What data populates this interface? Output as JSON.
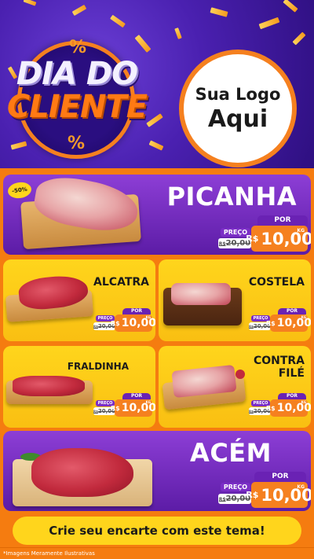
{
  "header": {
    "badge_line1": "DIA DO",
    "badge_line2": "CLIENTE",
    "percent_symbol": "%",
    "logo_line1": "Sua Logo",
    "logo_line2": "Aqui"
  },
  "products": [
    {
      "name": "PICANHA",
      "discount": "-50%",
      "por": "POR",
      "preco_label": "PREÇO",
      "old_prefix": "R$",
      "old_price": "20,00",
      "currency": "R$",
      "new_price": "10,00",
      "unit": "KG"
    },
    {
      "name": "ALCATRA",
      "por": "POR",
      "preco_label": "PREÇO",
      "old_prefix": "R$",
      "old_price": "20,00",
      "currency": "R$",
      "new_price": "10,00",
      "unit": "KG"
    },
    {
      "name": "COSTELA",
      "por": "POR",
      "preco_label": "PREÇO",
      "old_prefix": "R$",
      "old_price": "20,00",
      "currency": "R$",
      "new_price": "10,00",
      "unit": "KG"
    },
    {
      "name": "FRALDINHA",
      "por": "POR",
      "preco_label": "PREÇO",
      "old_prefix": "R$",
      "old_price": "20,00",
      "currency": "R$",
      "new_price": "10,00",
      "unit": "KG"
    },
    {
      "name_line1": "CONTRA",
      "name_line2": "FILÉ",
      "por": "POR",
      "preco_label": "PREÇO",
      "old_prefix": "R$",
      "old_price": "20,00",
      "currency": "R$",
      "new_price": "10,00",
      "unit": "KG"
    },
    {
      "name": "ACÉM",
      "por": "POR",
      "preco_label": "PREÇO",
      "old_prefix": "R$",
      "old_price": "20,00",
      "currency": "R$",
      "new_price": "10,00",
      "unit": "KG"
    }
  ],
  "cta": "Crie seu encarte com este tema!",
  "footer_note": "*Imagens Meramente Ilustrativas",
  "colors": {
    "orange": "#f57c10",
    "purple": "#6a22b4",
    "yellow": "#ffd51c",
    "header_bg": "#4a20b0"
  }
}
